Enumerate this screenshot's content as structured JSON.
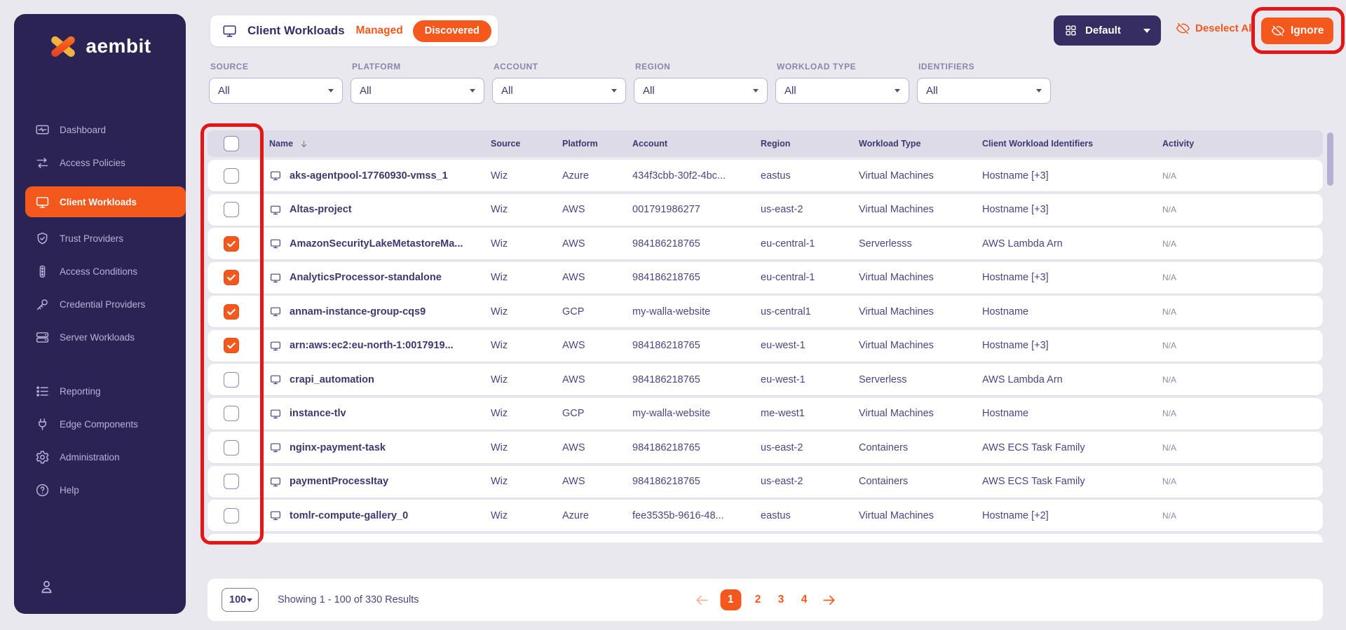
{
  "colors": {
    "accent": "#f4581c",
    "sidebar_bg": "#2a2353",
    "annotation_red": "#e31717"
  },
  "brand": {
    "logo_text": "aembit"
  },
  "sidebar": {
    "main_items": [
      {
        "label": "Dashboard",
        "icon": "dashboard-icon",
        "active": false
      },
      {
        "label": "Access Policies",
        "icon": "access-policies-icon",
        "active": false
      },
      {
        "label": "Client Workloads",
        "icon": "client-workloads-icon",
        "active": true
      },
      {
        "label": "Trust Providers",
        "icon": "trust-providers-icon",
        "active": false
      },
      {
        "label": "Access Conditions",
        "icon": "access-conditions-icon",
        "active": false
      },
      {
        "label": "Credential Providers",
        "icon": "credential-providers-icon",
        "active": false
      },
      {
        "label": "Server Workloads",
        "icon": "server-workloads-icon",
        "active": false
      }
    ],
    "secondary_items": [
      {
        "label": "Reporting",
        "icon": "reporting-icon",
        "active": false
      },
      {
        "label": "Edge Components",
        "icon": "edge-components-icon",
        "active": false
      },
      {
        "label": "Administration",
        "icon": "administration-icon",
        "active": false
      },
      {
        "label": "Help",
        "icon": "help-icon",
        "active": false
      }
    ]
  },
  "header": {
    "title": "Client Workloads",
    "managed_label": "Managed",
    "discovered_label": "Discovered",
    "view_selector_label": "Default",
    "deselect_all_label": "Deselect All",
    "ignore_label": "Ignore"
  },
  "filters": [
    {
      "label": "SOURCE",
      "value": "All"
    },
    {
      "label": "PLATFORM",
      "value": "All"
    },
    {
      "label": "ACCOUNT",
      "value": "All"
    },
    {
      "label": "REGION",
      "value": "All"
    },
    {
      "label": "WORKLOAD TYPE",
      "value": "All"
    },
    {
      "label": "IDENTIFIERS",
      "value": "All"
    }
  ],
  "table": {
    "columns": [
      "Name",
      "Source",
      "Platform",
      "Account",
      "Region",
      "Workload Type",
      "Client Workload Identifiers",
      "Activity"
    ],
    "sort_column": "Name",
    "rows": [
      {
        "checked": false,
        "name": "aks-agentpool-17760930-vmss_1",
        "source": "Wiz",
        "platform": "Azure",
        "account": "434f3cbb-30f2-4bc...",
        "region": "eastus",
        "workload_type": "Virtual Machines",
        "identifiers": "Hostname [+3]",
        "activity": "N/A"
      },
      {
        "checked": false,
        "name": "Altas-project",
        "source": "Wiz",
        "platform": "AWS",
        "account": "001791986277",
        "region": "us-east-2",
        "workload_type": "Virtual Machines",
        "identifiers": "Hostname [+3]",
        "activity": "N/A"
      },
      {
        "checked": true,
        "name": "AmazonSecurityLakeMetastoreMa...",
        "source": "Wiz",
        "platform": "AWS",
        "account": "984186218765",
        "region": "eu-central-1",
        "workload_type": "Serverlesss",
        "identifiers": "AWS Lambda Arn",
        "activity": "N/A"
      },
      {
        "checked": true,
        "name": "AnalyticsProcessor-standalone",
        "source": "Wiz",
        "platform": "AWS",
        "account": "984186218765",
        "region": "eu-central-1",
        "workload_type": "Virtual Machines",
        "identifiers": "Hostname [+3]",
        "activity": "N/A"
      },
      {
        "checked": true,
        "name": "annam-instance-group-cqs9",
        "source": "Wiz",
        "platform": "GCP",
        "account": "my-walla-website",
        "region": "us-central1",
        "workload_type": "Virtual Machines",
        "identifiers": "Hostname",
        "activity": "N/A"
      },
      {
        "checked": true,
        "name": "arn:aws:ec2:eu-north-1:0017919...",
        "source": "Wiz",
        "platform": "AWS",
        "account": "984186218765",
        "region": "eu-west-1",
        "workload_type": "Virtual Machines",
        "identifiers": "Hostname [+3]",
        "activity": "N/A"
      },
      {
        "checked": false,
        "name": "crapi_automation",
        "source": "Wiz",
        "platform": "AWS",
        "account": "984186218765",
        "region": "eu-west-1",
        "workload_type": "Serverless",
        "identifiers": "AWS Lambda Arn",
        "activity": "N/A"
      },
      {
        "checked": false,
        "name": "instance-tlv",
        "source": "Wiz",
        "platform": "GCP",
        "account": "my-walla-website",
        "region": "me-west1",
        "workload_type": "Virtual Machines",
        "identifiers": "Hostname",
        "activity": "N/A"
      },
      {
        "checked": false,
        "name": "nginx-payment-task",
        "source": "Wiz",
        "platform": "AWS",
        "account": "984186218765",
        "region": "us-east-2",
        "workload_type": "Containers",
        "identifiers": "AWS ECS Task Family",
        "activity": "N/A"
      },
      {
        "checked": false,
        "name": "paymentProcessItay",
        "source": "Wiz",
        "platform": "AWS",
        "account": "984186218765",
        "region": "us-east-2",
        "workload_type": "Containers",
        "identifiers": "AWS ECS Task Family",
        "activity": "N/A"
      },
      {
        "checked": false,
        "name": "tomlr-compute-gallery_0",
        "source": "Wiz",
        "platform": "Azure",
        "account": "fee3535b-9616-48...",
        "region": "eastus",
        "workload_type": "Virtual Machines",
        "identifiers": "Hostname [+2]",
        "activity": "N/A"
      }
    ]
  },
  "footer": {
    "page_size": "100",
    "summary": "Showing 1 - 100 of 330 Results",
    "pages": [
      "1",
      "2",
      "3",
      "4"
    ],
    "current_page": "1"
  }
}
